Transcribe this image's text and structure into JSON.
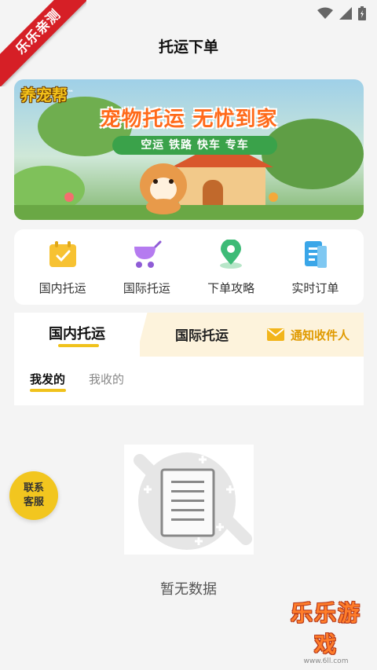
{
  "ribbon": "乐乐亲测",
  "header": {
    "title": "托运下单"
  },
  "banner": {
    "brand": "养宠帮",
    "trademark": "™",
    "slogan": "宠物托运  无忧到家",
    "modes": "空运 铁路 快车 专车"
  },
  "quick_actions": [
    {
      "label": "国内托运",
      "icon": "calendar-check-icon",
      "color": "#f7c232"
    },
    {
      "label": "国际托运",
      "icon": "pet-stroller-icon",
      "color": "#b57bf0"
    },
    {
      "label": "下单攻略",
      "icon": "map-pin-icon",
      "color": "#3dbb77"
    },
    {
      "label": "实时订单",
      "icon": "document-icon",
      "color": "#3aa6e8"
    }
  ],
  "tabs": {
    "domestic": "国内托运",
    "international": "国际托运",
    "notify": "通知收件人"
  },
  "subtabs": {
    "sent": "我发的",
    "received": "我收的"
  },
  "empty": {
    "text": "暂无数据"
  },
  "contact": {
    "line1": "联系",
    "line2": "客服"
  },
  "watermark": {
    "big": "乐乐游戏",
    "small": "www.6ll.com"
  },
  "colors": {
    "accent": "#f0c21c",
    "background": "#f4f4f4"
  }
}
